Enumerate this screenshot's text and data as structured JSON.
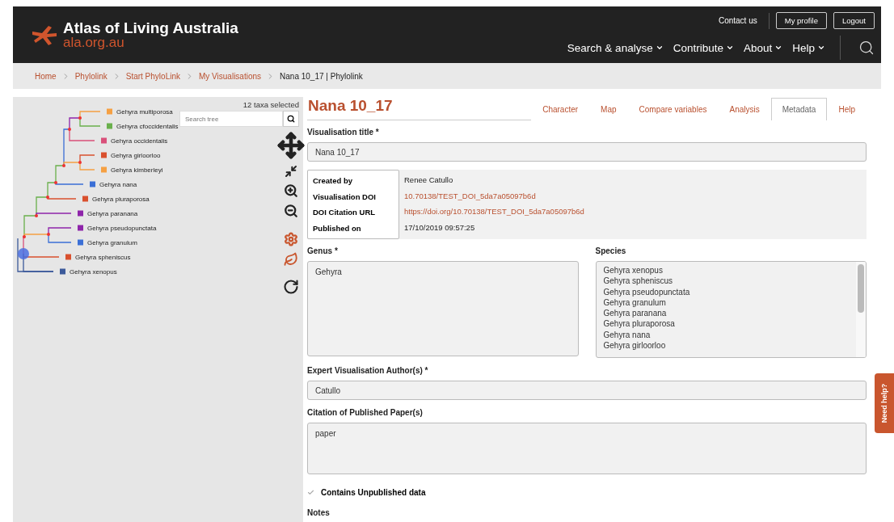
{
  "header": {
    "title": "Atlas of Living Australia",
    "subtitle": "ala.org.au",
    "top_links": [
      {
        "label": "Contact us",
        "kind": "link"
      },
      {
        "label": "My profile",
        "kind": "button"
      },
      {
        "label": "Logout",
        "kind": "button"
      }
    ],
    "nav": [
      "Search & analyse",
      "Contribute",
      "About",
      "Help"
    ]
  },
  "breadcrumb": [
    {
      "label": "Home",
      "current": false
    },
    {
      "label": "Phylolink",
      "current": false
    },
    {
      "label": "Start PhyloLink",
      "current": false
    },
    {
      "label": "My Visualisations",
      "current": false
    },
    {
      "label": "Nana 10_17 | Phylolink",
      "current": true
    }
  ],
  "tree": {
    "selection_count": "12 taxa selected",
    "search_placeholder": "Search tree",
    "taxa": [
      {
        "name": "Gehyra multiporosa",
        "color": "#f5a043"
      },
      {
        "name": "Gehyra cfoccidentalis",
        "color": "#6ab04c"
      },
      {
        "name": "Gehyra occidentalis",
        "color": "#d9507a"
      },
      {
        "name": "Gehyra girloorloo",
        "color": "#d9502e"
      },
      {
        "name": "Gehyra kimberleyi",
        "color": "#f5a043"
      },
      {
        "name": "Gehyra nana",
        "color": "#3b6fd6"
      },
      {
        "name": "Gehyra pluraporosa",
        "color": "#d9502e"
      },
      {
        "name": "Gehyra paranana",
        "color": "#8e24aa"
      },
      {
        "name": "Gehyra pseudopunctata",
        "color": "#8e24aa"
      },
      {
        "name": "Gehyra granulum",
        "color": "#3b6fd6"
      },
      {
        "name": "Gehyra spheniscus",
        "color": "#d9502e"
      },
      {
        "name": "Gehyra xenopus",
        "color": "#3c5a9a"
      }
    ]
  },
  "main": {
    "title": "Nana 10_17",
    "tabs": [
      {
        "label": "Character",
        "selected": false
      },
      {
        "label": "Map",
        "selected": false
      },
      {
        "label": "Compare variables",
        "selected": false
      },
      {
        "label": "Analysis",
        "selected": false
      },
      {
        "label": "Metadata",
        "selected": true
      },
      {
        "label": "Help",
        "selected": false
      }
    ],
    "visualisation_title": {
      "label": "Visualisation title *",
      "value": "Nana 10_17"
    },
    "info": [
      {
        "label": "Created by",
        "value": "Renee Catullo",
        "kind": "text"
      },
      {
        "label": "Visualisation DOI",
        "value": "10.70138/TEST_DOI_5da7a05097b6d",
        "kind": "link"
      },
      {
        "label": "DOI Citation URL",
        "value": "https://doi.org/10.70138/TEST_DOI_5da7a05097b6d",
        "kind": "link"
      },
      {
        "label": "Published on",
        "value": "17/10/2019 09:57:25",
        "kind": "text"
      }
    ],
    "genus": {
      "label": "Genus *",
      "value": "Gehyra"
    },
    "species": {
      "label": "Species",
      "items": [
        "Gehyra xenopus",
        "Gehyra spheniscus",
        "Gehyra pseudopunctata",
        "Gehyra granulum",
        "Gehyra paranana",
        "Gehyra pluraporosa",
        "Gehyra nana",
        "Gehyra girloorloo"
      ]
    },
    "authors": {
      "label": "Expert Visualisation Author(s) *",
      "value": "Catullo"
    },
    "citation": {
      "label": "Citation of Published Paper(s)",
      "value": "paper"
    },
    "unpublished": {
      "label": "Contains Unpublished data",
      "checked": true
    },
    "notes_label": "Notes"
  },
  "help_tab": "Need help?"
}
